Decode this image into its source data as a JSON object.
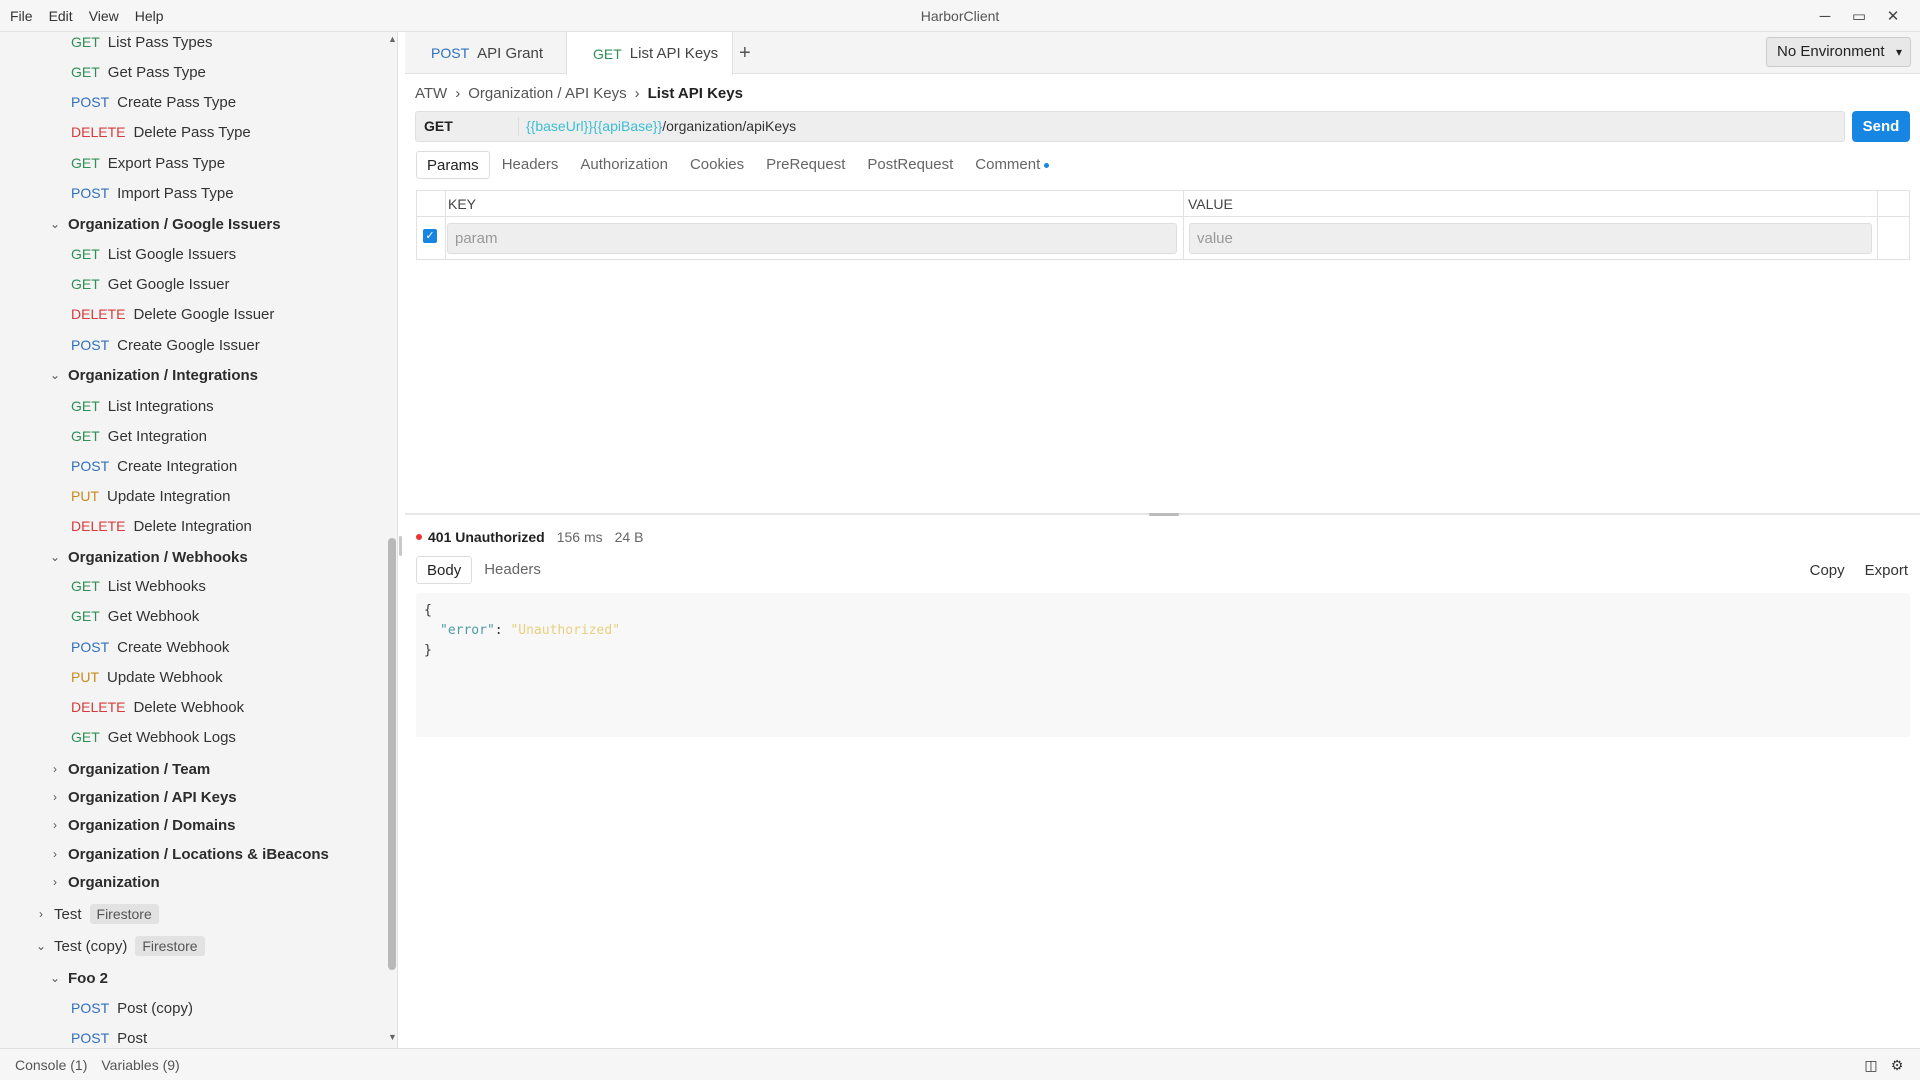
{
  "app": {
    "title": "HarborClient"
  },
  "menu": [
    "File",
    "Edit",
    "View",
    "Help"
  ],
  "window_controls": {
    "minimize": "─",
    "maximize": "▭",
    "close": "✕"
  },
  "sidebar": {
    "rows": [
      {
        "kind": "request",
        "method": "GET",
        "label": "List Pass Types"
      },
      {
        "kind": "request",
        "method": "GET",
        "label": "Get Pass Type"
      },
      {
        "kind": "request",
        "method": "POST",
        "label": "Create Pass Type"
      },
      {
        "kind": "request",
        "method": "DELETE",
        "label": "Delete Pass Type"
      },
      {
        "kind": "request",
        "method": "GET",
        "label": "Export Pass Type"
      },
      {
        "kind": "request",
        "method": "POST",
        "label": "Import Pass Type"
      },
      {
        "kind": "folder",
        "expanded": true,
        "label": "Organization / Google Issuers"
      },
      {
        "kind": "request",
        "method": "GET",
        "label": "List Google Issuers"
      },
      {
        "kind": "request",
        "method": "GET",
        "label": "Get Google Issuer"
      },
      {
        "kind": "request",
        "method": "DELETE",
        "label": "Delete Google Issuer"
      },
      {
        "kind": "request",
        "method": "POST",
        "label": "Create Google Issuer"
      },
      {
        "kind": "folder",
        "expanded": true,
        "label": "Organization / Integrations"
      },
      {
        "kind": "request",
        "method": "GET",
        "label": "List Integrations"
      },
      {
        "kind": "request",
        "method": "GET",
        "label": "Get Integration"
      },
      {
        "kind": "request",
        "method": "POST",
        "label": "Create Integration"
      },
      {
        "kind": "request",
        "method": "PUT",
        "label": "Update Integration"
      },
      {
        "kind": "request",
        "method": "DELETE",
        "label": "Delete Integration"
      },
      {
        "kind": "folder",
        "expanded": true,
        "label": "Organization / Webhooks"
      },
      {
        "kind": "request",
        "method": "GET",
        "label": "List Webhooks"
      },
      {
        "kind": "request",
        "method": "GET",
        "label": "Get Webhook"
      },
      {
        "kind": "request",
        "method": "POST",
        "label": "Create Webhook"
      },
      {
        "kind": "request",
        "method": "PUT",
        "label": "Update Webhook"
      },
      {
        "kind": "request",
        "method": "DELETE",
        "label": "Delete Webhook"
      },
      {
        "kind": "request",
        "method": "GET",
        "label": "Get Webhook Logs"
      },
      {
        "kind": "folder",
        "expanded": false,
        "label": "Organization / Team"
      },
      {
        "kind": "folder",
        "expanded": false,
        "label": "Organization / API Keys"
      },
      {
        "kind": "folder",
        "expanded": false,
        "label": "Organization / Domains"
      },
      {
        "kind": "folder",
        "expanded": false,
        "label": "Organization / Locations & iBeacons"
      },
      {
        "kind": "folder",
        "expanded": false,
        "label": "Organization"
      },
      {
        "kind": "collection",
        "expanded": false,
        "label": "Test",
        "tag": "Firestore"
      },
      {
        "kind": "collection",
        "expanded": true,
        "label": "Test (copy)",
        "tag": "Firestore"
      },
      {
        "kind": "folder",
        "expanded": true,
        "label": "Foo 2"
      },
      {
        "kind": "request",
        "method": "POST",
        "label": "Post (copy)"
      },
      {
        "kind": "request",
        "method": "POST",
        "label": "Post"
      }
    ]
  },
  "tabs": [
    {
      "method": "POST",
      "label": "API Grant",
      "active": false
    },
    {
      "method": "GET",
      "label": "List API Keys",
      "active": true
    }
  ],
  "add_tab": "+",
  "environment": {
    "selected": "No Environment"
  },
  "breadcrumb": {
    "items": [
      "ATW",
      "Organization / API Keys"
    ],
    "current": "List API Keys"
  },
  "request": {
    "method": "GET",
    "url_var1": "{{baseUrl}}",
    "url_var2": "{{apiBase}}",
    "url_path": "/organization/apiKeys",
    "send_label": "Send"
  },
  "request_tabs": [
    "Params",
    "Headers",
    "Authorization",
    "Cookies",
    "PreRequest",
    "PostRequest",
    "Comment"
  ],
  "params": {
    "key_header": "KEY",
    "value_header": "VALUE",
    "key_placeholder": "param",
    "value_placeholder": "value"
  },
  "response": {
    "status": "401 Unauthorized",
    "time": "156 ms",
    "size": "24 B",
    "tabs": [
      "Body",
      "Headers"
    ],
    "copy_label": "Copy",
    "export_label": "Export",
    "body_open": "{",
    "body_key": "\"error\"",
    "body_colon": ": ",
    "body_value": "\"Unauthorized\"",
    "body_close": "}"
  },
  "statusbar": {
    "console": "Console (1)",
    "variables": "Variables (9)"
  },
  "colors": {
    "accent": "#1786e3",
    "get": "#2f8f55",
    "post": "#2f6fbf",
    "delete": "#d83a3a",
    "put": "#c98a1a"
  }
}
